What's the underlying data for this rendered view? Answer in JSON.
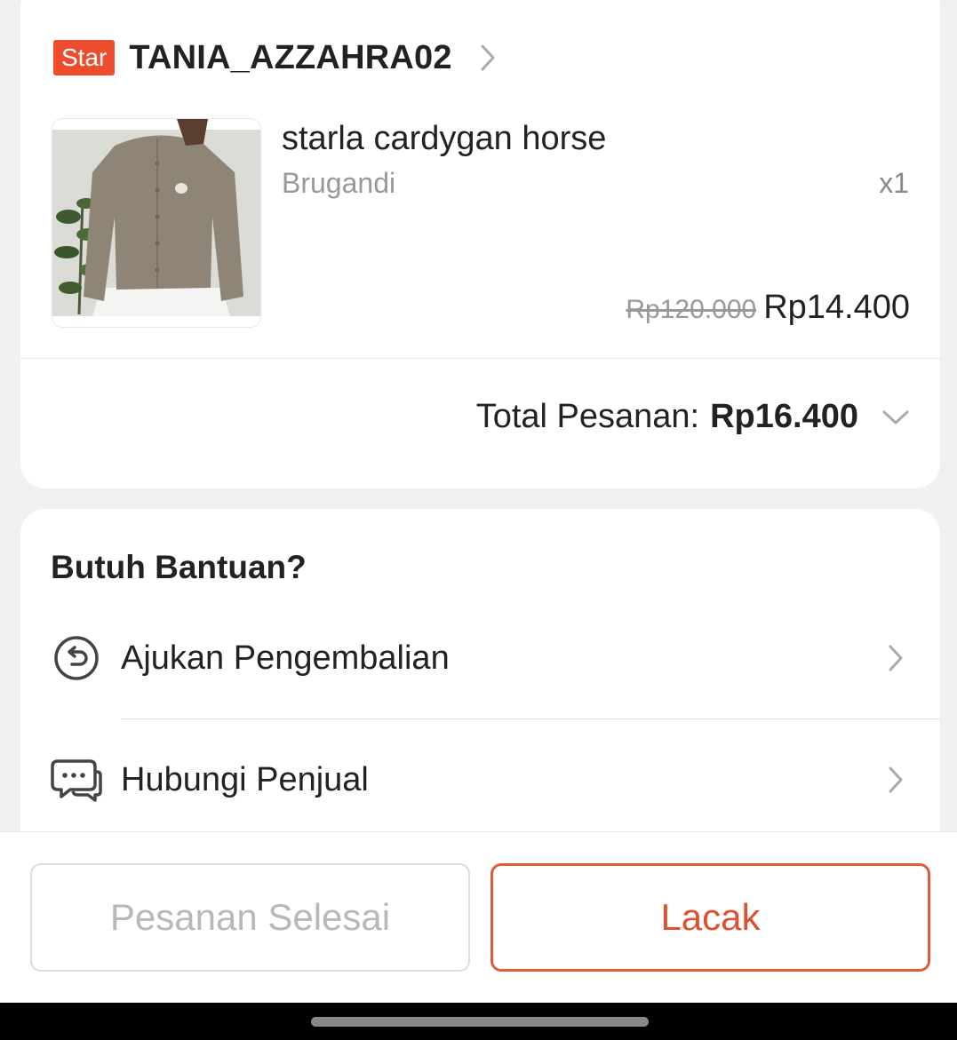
{
  "order": {
    "shop": {
      "badge": "Star",
      "name": "TANIA_AZZAHRA02"
    },
    "product": {
      "name": "starla cardygan horse",
      "variant": "Brugandi",
      "quantity": "x1",
      "original_price": "Rp120.000",
      "price": "Rp14.400"
    },
    "total": {
      "label": "Total Pesanan:",
      "value": "Rp16.400"
    }
  },
  "help": {
    "title": "Butuh Bantuan?",
    "items": [
      {
        "label": "Ajukan Pengembalian",
        "icon": "return-icon"
      },
      {
        "label": "Hubungi Penjual",
        "icon": "chat-icon"
      }
    ]
  },
  "actions": {
    "done_label": "Pesanan Selesai",
    "track_label": "Lacak"
  },
  "colors": {
    "accent": "#ee4d2d",
    "track_text": "#e0502f",
    "disabled_text": "#b8b8b8"
  }
}
